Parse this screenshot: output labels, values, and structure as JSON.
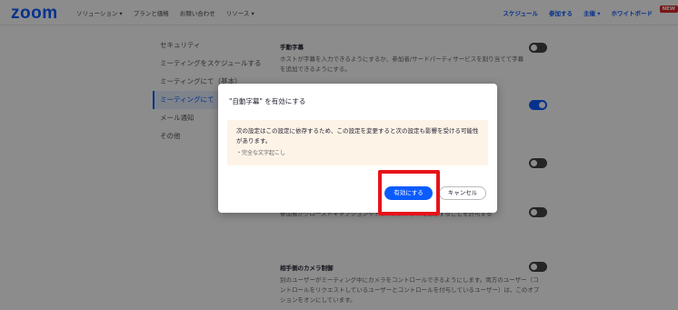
{
  "header": {
    "logo": "zoom",
    "nav": [
      "ソリューション ▾",
      "プランと価格",
      "お問い合わせ",
      "リソース ▾"
    ],
    "right_nav": [
      "スケジュール",
      "参加する",
      "主催 ▾",
      "ホワイトボード"
    ],
    "new_badge": "NEW"
  },
  "sidebar": {
    "items": [
      {
        "label": "セキュリティ"
      },
      {
        "label": "ミーティングをスケジュールする"
      },
      {
        "label": "ミーティングにて（基本）"
      },
      {
        "label": "ミーティングにて（詳細）"
      },
      {
        "label": "メール通知"
      },
      {
        "label": "その他"
      }
    ]
  },
  "settings": [
    {
      "title": "手動字幕",
      "desc": "ホストが字幕を入力できるようにするか、参加者/サードパーティサービスを割り当てて字幕を追加できるようにする。",
      "state": "off"
    },
    {
      "title": "",
      "desc": "",
      "state": "on"
    },
    {
      "title": "",
      "desc": "",
      "state": "off"
    },
    {
      "title": "トランスクリプトを保存",
      "desc": "参加者がクローズドキャプションやトランスクリプトを保存することを許可する",
      "state": "off"
    },
    {
      "title": "相手側のカメラ制御",
      "desc": "別のユーザーがミーティング中にカメラをコントロールできるようにします。両方のユーザー（コントロールをリクエストしているユーザーとコントロールを付与しているユーザー）は、このオプションをオンにしています。",
      "state": "off"
    }
  ],
  "dialog": {
    "title": "\"自動字幕\" を有効にする",
    "warning": "次の設定はこの設定に依存するため、この設定を変更すると次の設定も影響を受ける可能性があります。",
    "dependent_item": "・完全な文字起こし",
    "confirm_label": "有効にする",
    "cancel_label": "キャンセル"
  },
  "colors": {
    "accent": "#0b5cff",
    "highlight": "#e8121a",
    "warning_bg": "#fdf3e7"
  }
}
